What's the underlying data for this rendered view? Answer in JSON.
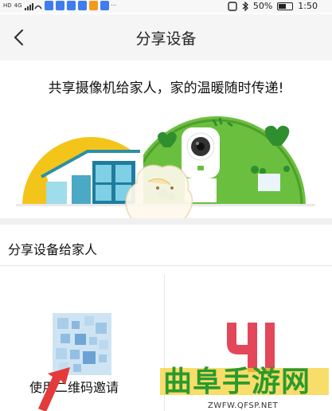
{
  "status_bar": {
    "network": "HD",
    "signal_small": "4G",
    "battery": "50%",
    "time": "1:50"
  },
  "header": {
    "title": "分享设备"
  },
  "banner": {
    "text": "共享摄像机给家人，家的温暖随时传递!"
  },
  "section": {
    "title": "分享设备给家人"
  },
  "cards": {
    "qr_label": "使用二维码邀请",
    "yi_logo": "YI"
  },
  "watermark": {
    "text": "曲阜手游网",
    "url": "ZWFW.QFSP.NET"
  },
  "colors": {
    "accent_yellow": "#f3c51a",
    "accent_green": "#6abf3f",
    "yi_red": "#e4475a"
  }
}
